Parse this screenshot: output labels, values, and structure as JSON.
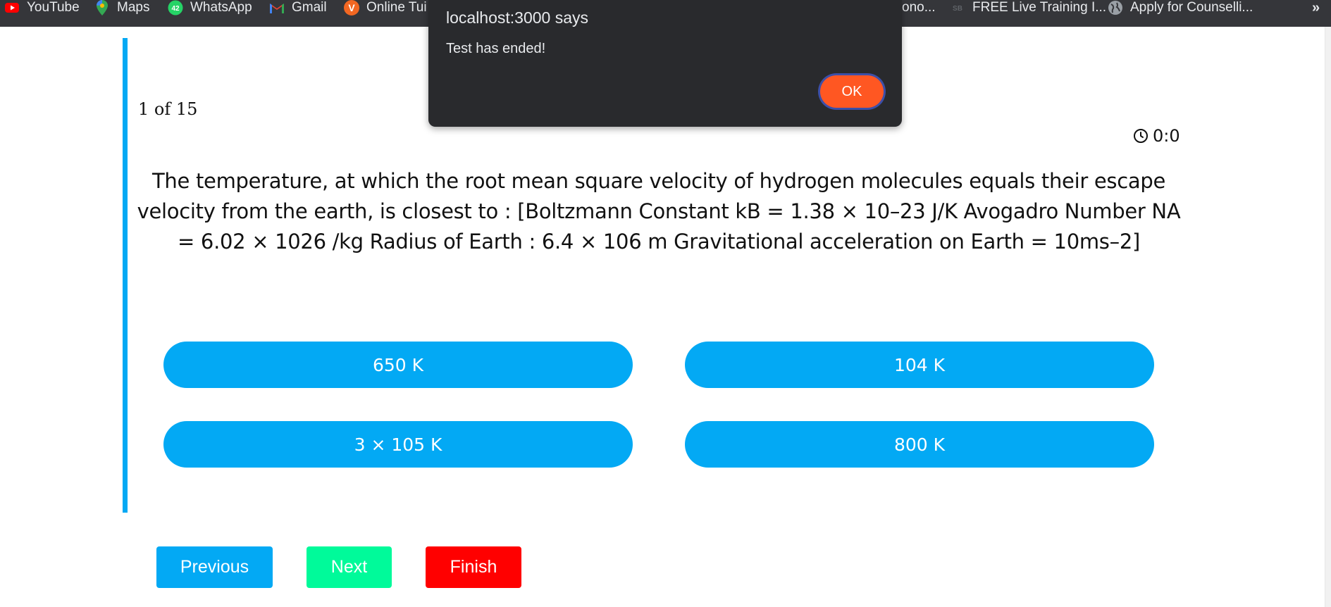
{
  "bookmarks": [
    {
      "label": "YouTube",
      "icon": "youtube-icon",
      "color": "#ff0000"
    },
    {
      "label": "Maps",
      "icon": "maps-pin-icon",
      "color": "#34a853"
    },
    {
      "label": "WhatsApp",
      "icon": "whatsapp-icon",
      "color": "#25d366",
      "badge": "42"
    },
    {
      "label": "Gmail",
      "icon": "gmail-icon",
      "color": "#ea4335"
    },
    {
      "label": "Online Tui",
      "icon": "v-logo-icon",
      "color": "#f26722"
    },
    {
      "label": "ono...",
      "icon": "",
      "color": ""
    },
    {
      "label": "FREE Live Training I...",
      "icon": "sb-logo-icon",
      "color": "#444"
    },
    {
      "label": "Apply for Counselli...",
      "icon": "globe-icon",
      "color": "#9aa0a6"
    }
  ],
  "bookmarks_overflow": "»",
  "quiz": {
    "counter": "1 of 15",
    "timer": "0:0",
    "question": "The temperature, at which the root mean square velocity of hydrogen molecules equals their escape velocity from the earth, is closest to : [Boltzmann Constant kB = 1.38 × 10–23 J/K Avogadro Number NA = 6.02 × 1026 /kg Radius of Earth : 6.4 × 106 m Gravitational acceleration on Earth = 10ms–2]",
    "options": [
      "650 K",
      "104 K",
      "3 × 105 K",
      "800 K"
    ]
  },
  "nav": {
    "previous": "Previous",
    "next": "Next",
    "finish": "Finish"
  },
  "dialog": {
    "origin": "localhost:3000 says",
    "message": "Test has ended!",
    "ok": "OK"
  },
  "colors": {
    "accent": "#03a9f4",
    "next": "#00fa9a",
    "finish": "#ff0000",
    "ok": "#ff5722"
  }
}
